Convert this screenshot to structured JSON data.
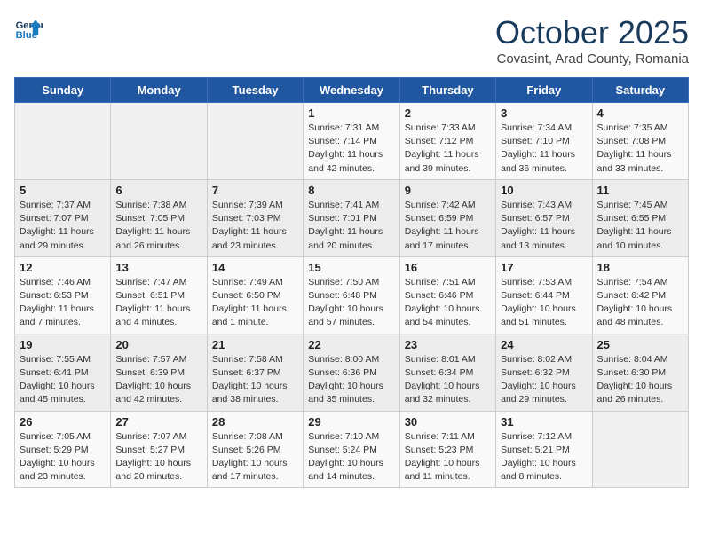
{
  "header": {
    "logo_line1": "General",
    "logo_line2": "Blue",
    "month": "October 2025",
    "location": "Covasint, Arad County, Romania"
  },
  "weekdays": [
    "Sunday",
    "Monday",
    "Tuesday",
    "Wednesday",
    "Thursday",
    "Friday",
    "Saturday"
  ],
  "weeks": [
    [
      {
        "day": "",
        "info": ""
      },
      {
        "day": "",
        "info": ""
      },
      {
        "day": "",
        "info": ""
      },
      {
        "day": "1",
        "info": "Sunrise: 7:31 AM\nSunset: 7:14 PM\nDaylight: 11 hours and 42 minutes."
      },
      {
        "day": "2",
        "info": "Sunrise: 7:33 AM\nSunset: 7:12 PM\nDaylight: 11 hours and 39 minutes."
      },
      {
        "day": "3",
        "info": "Sunrise: 7:34 AM\nSunset: 7:10 PM\nDaylight: 11 hours and 36 minutes."
      },
      {
        "day": "4",
        "info": "Sunrise: 7:35 AM\nSunset: 7:08 PM\nDaylight: 11 hours and 33 minutes."
      }
    ],
    [
      {
        "day": "5",
        "info": "Sunrise: 7:37 AM\nSunset: 7:07 PM\nDaylight: 11 hours and 29 minutes."
      },
      {
        "day": "6",
        "info": "Sunrise: 7:38 AM\nSunset: 7:05 PM\nDaylight: 11 hours and 26 minutes."
      },
      {
        "day": "7",
        "info": "Sunrise: 7:39 AM\nSunset: 7:03 PM\nDaylight: 11 hours and 23 minutes."
      },
      {
        "day": "8",
        "info": "Sunrise: 7:41 AM\nSunset: 7:01 PM\nDaylight: 11 hours and 20 minutes."
      },
      {
        "day": "9",
        "info": "Sunrise: 7:42 AM\nSunset: 6:59 PM\nDaylight: 11 hours and 17 minutes."
      },
      {
        "day": "10",
        "info": "Sunrise: 7:43 AM\nSunset: 6:57 PM\nDaylight: 11 hours and 13 minutes."
      },
      {
        "day": "11",
        "info": "Sunrise: 7:45 AM\nSunset: 6:55 PM\nDaylight: 11 hours and 10 minutes."
      }
    ],
    [
      {
        "day": "12",
        "info": "Sunrise: 7:46 AM\nSunset: 6:53 PM\nDaylight: 11 hours and 7 minutes."
      },
      {
        "day": "13",
        "info": "Sunrise: 7:47 AM\nSunset: 6:51 PM\nDaylight: 11 hours and 4 minutes."
      },
      {
        "day": "14",
        "info": "Sunrise: 7:49 AM\nSunset: 6:50 PM\nDaylight: 11 hours and 1 minute."
      },
      {
        "day": "15",
        "info": "Sunrise: 7:50 AM\nSunset: 6:48 PM\nDaylight: 10 hours and 57 minutes."
      },
      {
        "day": "16",
        "info": "Sunrise: 7:51 AM\nSunset: 6:46 PM\nDaylight: 10 hours and 54 minutes."
      },
      {
        "day": "17",
        "info": "Sunrise: 7:53 AM\nSunset: 6:44 PM\nDaylight: 10 hours and 51 minutes."
      },
      {
        "day": "18",
        "info": "Sunrise: 7:54 AM\nSunset: 6:42 PM\nDaylight: 10 hours and 48 minutes."
      }
    ],
    [
      {
        "day": "19",
        "info": "Sunrise: 7:55 AM\nSunset: 6:41 PM\nDaylight: 10 hours and 45 minutes."
      },
      {
        "day": "20",
        "info": "Sunrise: 7:57 AM\nSunset: 6:39 PM\nDaylight: 10 hours and 42 minutes."
      },
      {
        "day": "21",
        "info": "Sunrise: 7:58 AM\nSunset: 6:37 PM\nDaylight: 10 hours and 38 minutes."
      },
      {
        "day": "22",
        "info": "Sunrise: 8:00 AM\nSunset: 6:36 PM\nDaylight: 10 hours and 35 minutes."
      },
      {
        "day": "23",
        "info": "Sunrise: 8:01 AM\nSunset: 6:34 PM\nDaylight: 10 hours and 32 minutes."
      },
      {
        "day": "24",
        "info": "Sunrise: 8:02 AM\nSunset: 6:32 PM\nDaylight: 10 hours and 29 minutes."
      },
      {
        "day": "25",
        "info": "Sunrise: 8:04 AM\nSunset: 6:30 PM\nDaylight: 10 hours and 26 minutes."
      }
    ],
    [
      {
        "day": "26",
        "info": "Sunrise: 7:05 AM\nSunset: 5:29 PM\nDaylight: 10 hours and 23 minutes."
      },
      {
        "day": "27",
        "info": "Sunrise: 7:07 AM\nSunset: 5:27 PM\nDaylight: 10 hours and 20 minutes."
      },
      {
        "day": "28",
        "info": "Sunrise: 7:08 AM\nSunset: 5:26 PM\nDaylight: 10 hours and 17 minutes."
      },
      {
        "day": "29",
        "info": "Sunrise: 7:10 AM\nSunset: 5:24 PM\nDaylight: 10 hours and 14 minutes."
      },
      {
        "day": "30",
        "info": "Sunrise: 7:11 AM\nSunset: 5:23 PM\nDaylight: 10 hours and 11 minutes."
      },
      {
        "day": "31",
        "info": "Sunrise: 7:12 AM\nSunset: 5:21 PM\nDaylight: 10 hours and 8 minutes."
      },
      {
        "day": "",
        "info": ""
      }
    ]
  ]
}
